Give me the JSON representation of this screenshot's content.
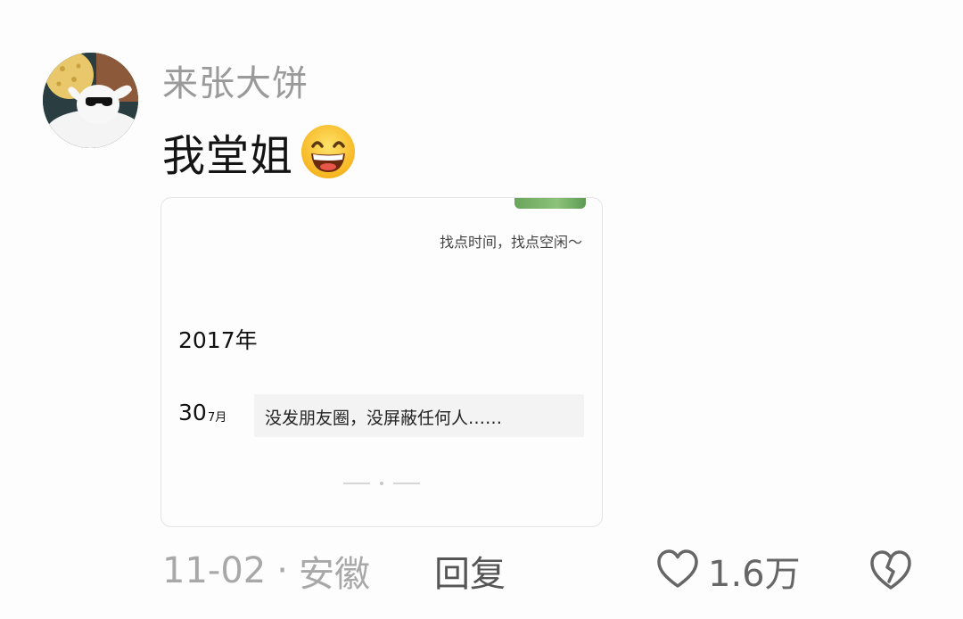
{
  "comment": {
    "username": "来张大饼",
    "text": "我堂姐",
    "emoji": "grinning-face-icon"
  },
  "screenshot_card": {
    "signature": "找点时间，找点空闲～",
    "year": "2017年",
    "day": "30",
    "month": "7月",
    "post_text": "没发朋友圈，没屏蔽任何人……"
  },
  "meta": {
    "date": "11-02",
    "separator": "·",
    "location": "安徽",
    "reply_label": "回复",
    "like_count": "1.6万"
  },
  "colors": {
    "username": "#9a9a9a",
    "meta": "#a8a8a8",
    "reply": "#555555",
    "card_border": "#e4e4e4"
  }
}
